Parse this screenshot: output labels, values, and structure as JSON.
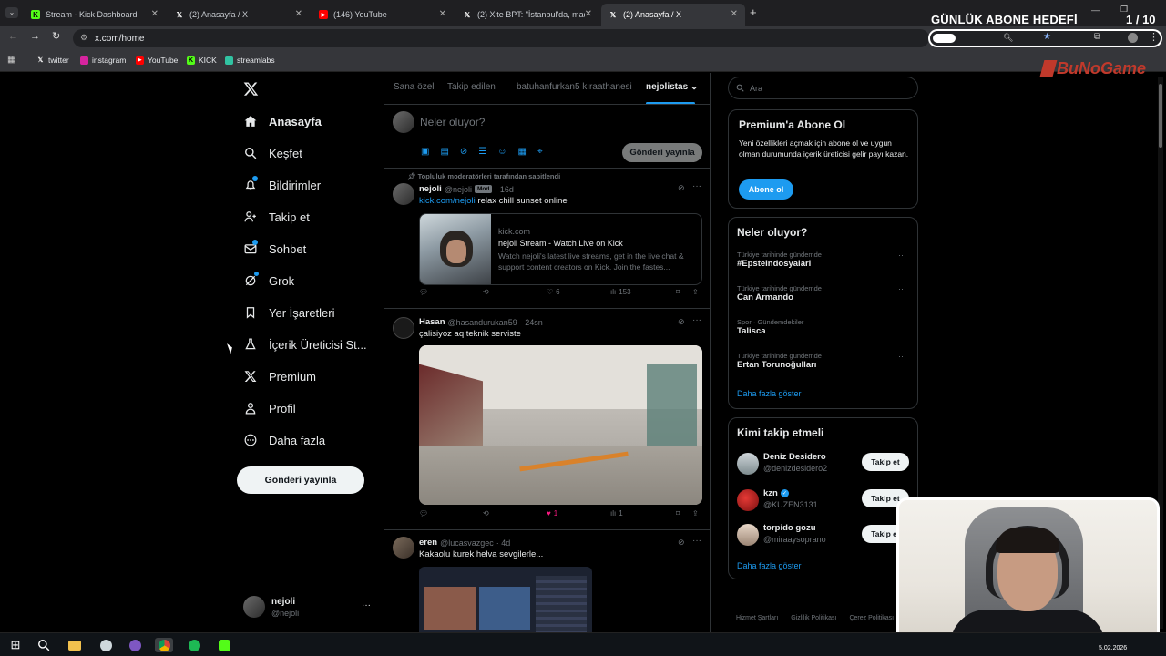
{
  "browser": {
    "tabs": [
      {
        "title": "Stream - Kick Dashboard",
        "icon": "kick-icon",
        "active": false
      },
      {
        "title": "(2) Anasayfa / X",
        "icon": "x-icon",
        "active": false
      },
      {
        "title": "(146) YouTube",
        "icon": "youtube-icon",
        "active": false
      },
      {
        "title": "(2) X'te BPT: \"İstanbul'da, madd",
        "icon": "x-icon",
        "active": false
      },
      {
        "title": "(2) Anasayfa / X",
        "icon": "x-icon",
        "active": true
      }
    ],
    "url": "x.com/home",
    "bookmarks": [
      "twitter",
      "instagram",
      "YouTube",
      "KICK",
      "streamlabs"
    ]
  },
  "overlay": {
    "goal_title": "GÜNLÜK ABONE HEDEFİ",
    "goal_count": "1 / 10",
    "goal_progress": 0.1,
    "brand": "BuNoGame"
  },
  "sidebar": {
    "items": [
      {
        "label": "Anasayfa",
        "icon": "home-icon",
        "bold": true
      },
      {
        "label": "Keşfet",
        "icon": "search-icon"
      },
      {
        "label": "Bildirimler",
        "icon": "bell-icon"
      },
      {
        "label": "Takip et",
        "icon": "add-user-icon"
      },
      {
        "label": "Sohbet",
        "icon": "mail-icon"
      },
      {
        "label": "Grok",
        "icon": "grok-icon"
      },
      {
        "label": "Yer İşaretleri",
        "icon": "bookmark-icon"
      },
      {
        "label": "İçerik Üreticisi St...",
        "icon": "flask-icon"
      },
      {
        "label": "Premium",
        "icon": "x-logo-icon"
      },
      {
        "label": "Profil",
        "icon": "person-icon"
      },
      {
        "label": "Daha fazla",
        "icon": "more-circle-icon"
      }
    ],
    "post_button": "Gönderi yayınla",
    "account": {
      "name": "nejoli",
      "handle": "@nejoli",
      "menu": "···"
    }
  },
  "timeline": {
    "tabs": [
      "Sana özel",
      "Takip edilen",
      "batuhanfurkan5 kıraathanesi",
      "nejolistas"
    ],
    "active_tab": 3,
    "composer_placeholder": "Neler oluyor?",
    "composer_button": "Gönderi yayınla",
    "posts": [
      {
        "pinned_label": "Topluluk moderatörleri tarafından sabitlendi",
        "name": "nejoli",
        "handle": "@nejoli",
        "badge": "Mod",
        "time": "· 16d",
        "link_text": "kick.com/nejoli",
        "text": " relax chill sunset online",
        "card": {
          "domain": "kick.com",
          "title": "nejoli Stream - Watch Live on Kick",
          "description": "Watch nejoli's latest live streams, get in the live chat & support content creators on Kick. Join the fastes..."
        },
        "likes": "6",
        "views": "153"
      },
      {
        "name": "Hasan",
        "handle": "@hasandurukan59",
        "time": "· 24sn",
        "text": "çalisiyoz aq teknik serviste",
        "likes": "1",
        "views": "1"
      },
      {
        "name": "eren",
        "handle": "@lucasvazgec",
        "time": "· 4d",
        "text": "Kakaolu kurek helva sevgilerle..."
      }
    ]
  },
  "right": {
    "search_placeholder": "Ara",
    "premium": {
      "title": "Premium'a Abone Ol",
      "text": "Yeni özellikleri açmak için abone ol ve uygun olman durumunda içerik üreticisi gelir payı kazan.",
      "button": "Abone ol"
    },
    "trends": {
      "title": "Neler oluyor?",
      "items": [
        {
          "context": "Türkiye tarihinde gündemde",
          "name": "#Epsteindosyalari"
        },
        {
          "context": "Türkiye tarihinde gündemde",
          "name": "Can Armando"
        },
        {
          "context": "Spor · Gündemdekiler",
          "name": "Talisca"
        },
        {
          "context": "Türkiye tarihinde gündemde",
          "name": "Ertan Torunoğulları"
        }
      ],
      "more": "Daha fazla göster"
    },
    "who_to_follow": {
      "title": "Kimi takip etmeli",
      "items": [
        {
          "name": "Deniz Desidero",
          "handle": "@denizdesidero2",
          "button": "Takip et"
        },
        {
          "name": "kzn",
          "handle": "@KUZEN3131",
          "button": "Takip et",
          "verified": true
        },
        {
          "name": "torpido gozu",
          "handle": "@miraaysoprano",
          "button": "Takip et"
        }
      ],
      "more": "Daha fazla göster"
    },
    "footer": [
      "Hizmet Şartları",
      "Gizlilik Politikası",
      "Çerez Politikası"
    ]
  },
  "taskbar": {
    "date": "5.02.2026"
  },
  "colors": {
    "accent": "#1d9bf0",
    "kick": "#53fc18",
    "like": "#f91880"
  }
}
